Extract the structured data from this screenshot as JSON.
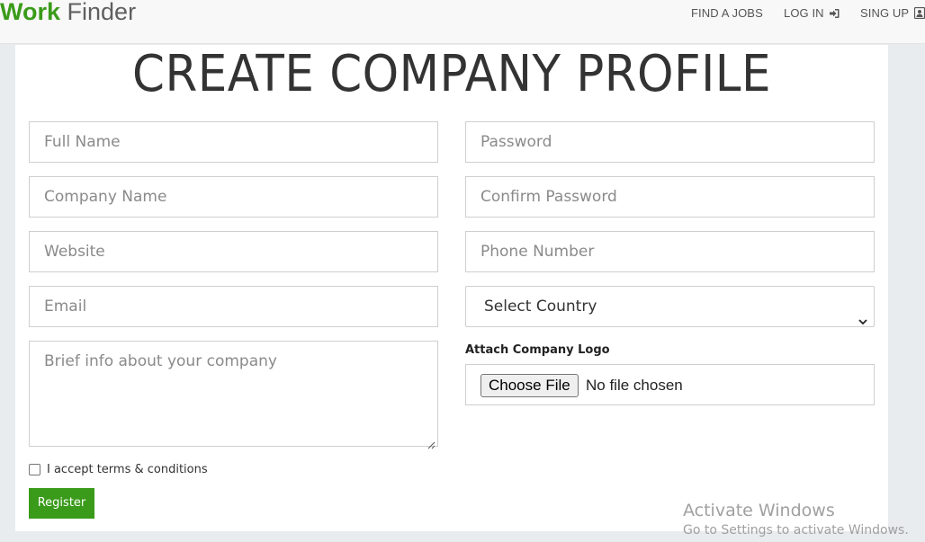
{
  "navbar": {
    "brand_part1": "Work",
    "brand_part2": "Finder",
    "find_jobs": "FIND A JOBS",
    "log_in": "LOG IN",
    "sign_up": "SING UP",
    "icons": [
      "sign-in-icon",
      "user-icon"
    ]
  },
  "page": {
    "title": "CREATE COMPANY PROFILE"
  },
  "form": {
    "full_name_placeholder": "Full Name",
    "company_name_placeholder": "Company Name",
    "website_placeholder": "Website",
    "email_placeholder": "Email",
    "brief_info_placeholder": "Brief info about your company",
    "password_placeholder": "Password",
    "confirm_password_placeholder": "Confirm Password",
    "phone_placeholder": "Phone Number",
    "country_selected": "Select Country",
    "logo_label": "Attach Company Logo",
    "choose_file_label": "Choose File",
    "no_file_text": "No file chosen",
    "terms_label": "I accept terms & conditions",
    "terms_checked": false,
    "register_label": "Register"
  },
  "watermark": {
    "line1": "Activate Windows",
    "line2": "Go to Settings to activate Windows."
  },
  "colors": {
    "brand_green": "#3a9b1a",
    "brand_gray": "#5f5f5f",
    "page_bg": "#e9ecef"
  }
}
